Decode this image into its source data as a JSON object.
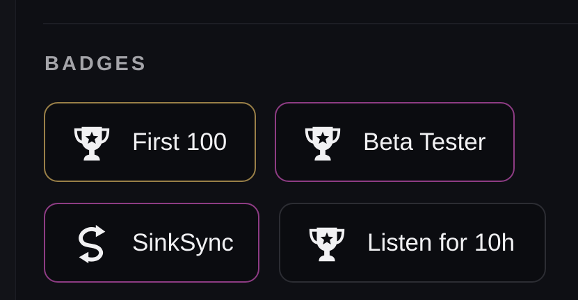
{
  "section": {
    "title": "BADGES"
  },
  "badges": [
    {
      "label": "First 100",
      "icon": "trophy-icon",
      "border_color": "#9a8048"
    },
    {
      "label": "Beta Tester",
      "icon": "trophy-icon",
      "border_color": "#8e3c84"
    },
    {
      "label": "SinkSync",
      "icon": "sync-icon",
      "border_color": "#8e3c84"
    },
    {
      "label": "Listen for 10h",
      "icon": "trophy-icon",
      "border_color": "#2c2d33"
    }
  ]
}
